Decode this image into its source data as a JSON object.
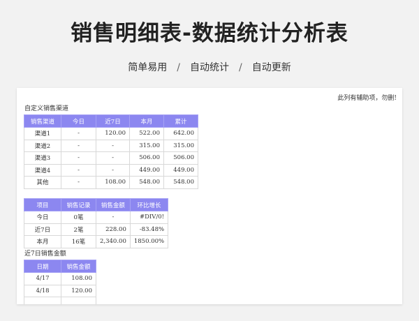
{
  "title": "销售明细表-数据统计分析表",
  "subtitle": {
    "items": [
      "简单易用",
      "自动统计",
      "自动更新"
    ],
    "separator": "/"
  },
  "sheet": {
    "note": "此列有辅助项，勿删!",
    "channel_table": {
      "label": "自定义销售渠道",
      "headers": [
        "销售渠道",
        "今日",
        "近7日",
        "本月",
        "累计"
      ],
      "rows": [
        [
          "渠道1",
          "-",
          "120.00",
          "522.00",
          "642.00"
        ],
        [
          "渠道2",
          "-",
          "-",
          "315.00",
          "315.00"
        ],
        [
          "渠道3",
          "-",
          "-",
          "506.00",
          "506.00"
        ],
        [
          "渠道4",
          "-",
          "-",
          "449.00",
          "449.00"
        ],
        [
          "其他",
          "-",
          "108.00",
          "548.00",
          "548.00"
        ]
      ]
    },
    "summary_table": {
      "headers": [
        "项目",
        "销售记录",
        "销售金额",
        "环比增长"
      ],
      "rows": [
        [
          "今日",
          "0笔",
          "-",
          "#DIV/0!"
        ],
        [
          "近7日",
          "2笔",
          "228.00",
          "-83.48%"
        ],
        [
          "本月",
          "16笔",
          "2,340.00",
          "1850.00%"
        ]
      ]
    },
    "daily_table": {
      "label": "近7日销售金额",
      "headers": [
        "日期",
        "销售金额"
      ],
      "rows": [
        [
          "4/17",
          "108.00"
        ],
        [
          "4/18",
          "120.00"
        ],
        [
          "",
          ""
        ]
      ]
    }
  },
  "colors": {
    "header_bg": "#8c87f0",
    "page_bg": "#f2f2f2"
  }
}
